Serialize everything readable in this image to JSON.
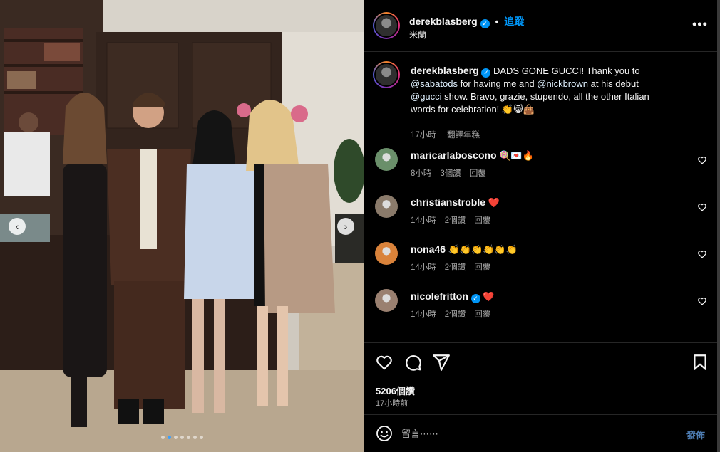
{
  "header": {
    "username": "derekblasberg",
    "separator": "•",
    "follow_label": "追蹤",
    "location": "米蘭",
    "more_icon": "more-horizontal-icon"
  },
  "caption": {
    "username": "derekblasberg",
    "text_part1": "DADS GONE GUCCI! Thank you to ",
    "mention1": "@sabatods",
    "text_part2": " for having me and ",
    "mention2": "@nickbrown",
    "text_part3": " at his debut ",
    "mention3": "@gucci",
    "text_part4": " show. Bravo, grazie, stupendo, all the other Italian words for celebration! 👏😸👜",
    "time": "17小時",
    "translate_label": "翻譯年糕"
  },
  "comments": [
    {
      "username": "maricarlaboscono",
      "text": "🍭💌🔥",
      "verified": false,
      "time": "8小時",
      "likes": "3個讚",
      "reply": "回覆",
      "avatar_color": "#6a8f6a"
    },
    {
      "username": "christianstroble",
      "text": "❤️",
      "verified": false,
      "time": "14小時",
      "likes": "2個讚",
      "reply": "回覆",
      "avatar_color": "#8a7a6a"
    },
    {
      "username": "nona46",
      "text": "👏👏👏👏👏👏",
      "verified": false,
      "time": "14小時",
      "likes": "2個讚",
      "reply": "回覆",
      "avatar_color": "#d9823a"
    },
    {
      "username": "nicolefritton",
      "text": "❤️",
      "verified": true,
      "time": "14小時",
      "likes": "2個讚",
      "reply": "回覆",
      "avatar_color": "#9a8070"
    }
  ],
  "actions": {
    "icons": [
      "heart-icon",
      "comment-icon",
      "share-icon",
      "bookmark-icon"
    ],
    "likes": "5206個讚",
    "time_ago": "17小時前"
  },
  "composer": {
    "placeholder": "留言⋯⋯",
    "post_label": "發佈",
    "emoji_icon": "emoji-icon"
  },
  "carousel": {
    "total_slides": 7,
    "active_slide": 2
  },
  "colors": {
    "accent": "#0095f6",
    "background": "#000000",
    "muted": "#a8a8a8",
    "heart_red": "#ff3040"
  }
}
